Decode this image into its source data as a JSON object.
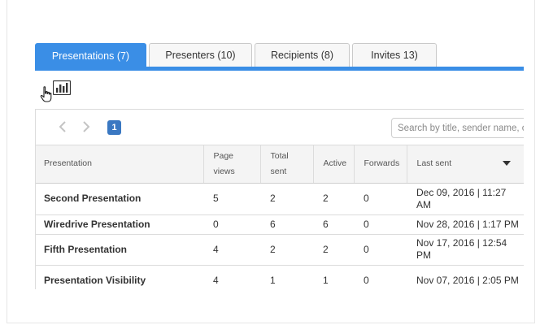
{
  "tabs": [
    {
      "label": "Presentations (7)",
      "active": true
    },
    {
      "label": "Presenters (10)",
      "active": false
    },
    {
      "label": "Recipients (8)",
      "active": false
    },
    {
      "label": "Invites 13)",
      "active": false
    }
  ],
  "toolbar": {
    "chart_icon": "bar-chart-icon",
    "cursor_icon": "hand-pointer-icon"
  },
  "pager": {
    "prev_icon": "chevron-left-icon",
    "next_icon": "chevron-right-icon",
    "current_page": "1"
  },
  "search": {
    "placeholder": "Search by title, sender name, or",
    "value": ""
  },
  "table": {
    "columns": [
      {
        "line1": "Presentation",
        "line2": ""
      },
      {
        "line1": "Page",
        "line2": "views"
      },
      {
        "line1": "Total",
        "line2": "sent"
      },
      {
        "line1": "Active",
        "line2": ""
      },
      {
        "line1": "Forwards",
        "line2": ""
      },
      {
        "line1": "Last sent",
        "line2": ""
      }
    ],
    "sort_icon": "caret-down-icon",
    "rows": [
      {
        "title": "Second Presentation",
        "page_views": "5",
        "total_sent": "2",
        "active": "2",
        "forwards": "0",
        "last_sent_1": "Dec 09, 2016 | 11:27",
        "last_sent_2": "AM"
      },
      {
        "title": "Wiredrive Presentation",
        "page_views": "0",
        "total_sent": "6",
        "active": "6",
        "forwards": "0",
        "last_sent_1": "Nov 28, 2016 | 1:17 PM",
        "last_sent_2": ""
      },
      {
        "title": "Fifth Presentation",
        "page_views": "4",
        "total_sent": "2",
        "active": "2",
        "forwards": "0",
        "last_sent_1": "Nov 17, 2016 | 12:54",
        "last_sent_2": "PM"
      },
      {
        "title": "Presentation Visibility",
        "page_views": "4",
        "total_sent": "1",
        "active": "1",
        "forwards": "0",
        "last_sent_1": "Nov 07, 2016 | 2:05 PM",
        "last_sent_2": ""
      }
    ]
  },
  "colors": {
    "accent": "#3a8ee6",
    "page_badge": "#3a78c2",
    "header_bg": "#f4f4f4"
  }
}
